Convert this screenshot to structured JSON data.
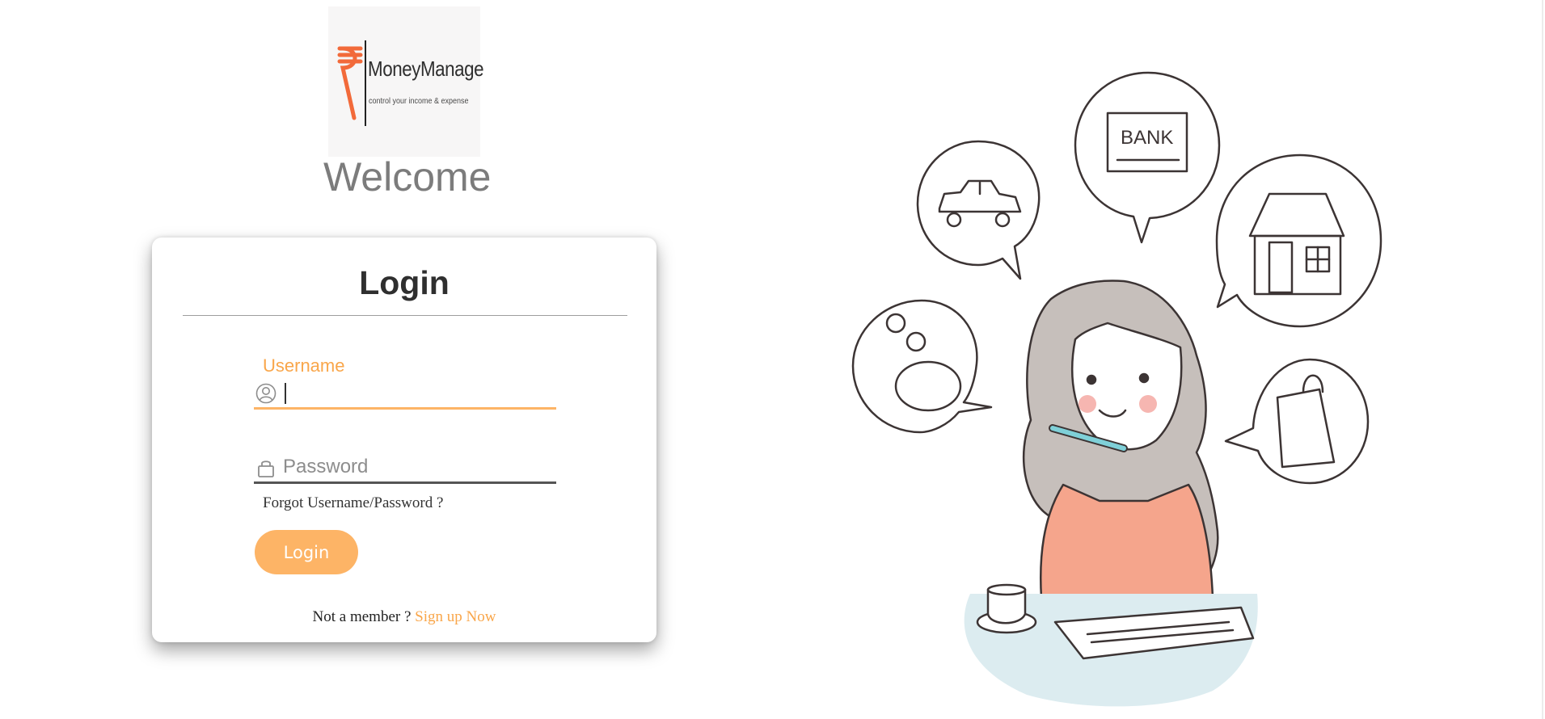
{
  "logo": {
    "brand_name": "MoneyManage",
    "tagline": "control your income & expense",
    "symbol": "₹",
    "accent_color": "#f26a3a"
  },
  "welcome_text": "Welcome",
  "login_card": {
    "title": "Login",
    "username": {
      "label": "Username",
      "value": "",
      "icon": "user-circle-icon"
    },
    "password": {
      "placeholder": "Password",
      "value": "",
      "icon": "lock-icon"
    },
    "forgot_link": "Forgot Username/Password ?",
    "submit_label": "Login",
    "signup_prompt": "Not a member ?",
    "signup_link": "Sign up Now"
  },
  "colors": {
    "accent": "#fdb466",
    "label_orange": "#f9a64a",
    "welcome_gray": "#7c7c7c"
  },
  "illustration": {
    "bank_sign": "BANK",
    "icons": [
      "car-icon",
      "bank-icon",
      "house-icon",
      "piggy-bank-icon",
      "shopping-bag-icon",
      "coffee-cup-icon",
      "pen-icon"
    ]
  }
}
